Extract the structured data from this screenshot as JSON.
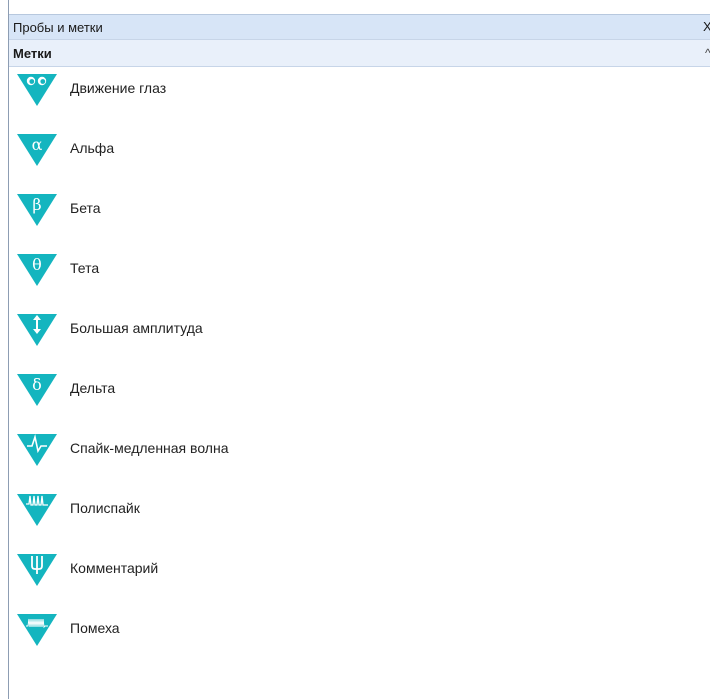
{
  "panel": {
    "title": "Пробы и метки",
    "close_symbol": "X",
    "section": "Метки",
    "collapse_symbol": "^"
  },
  "colors": {
    "marker_fill": "#14b5bf",
    "titlebar_bg": "#d7e5f7",
    "section_bg": "#e9f0fa"
  },
  "marks": [
    {
      "label": "Движение глаз",
      "icon": "eye-movement-icon",
      "glyph": ""
    },
    {
      "label": "Альфа",
      "icon": "alpha-icon",
      "glyph": "α"
    },
    {
      "label": "Бета",
      "icon": "beta-icon",
      "glyph": "β"
    },
    {
      "label": "Тета",
      "icon": "theta-icon",
      "glyph": "θ"
    },
    {
      "label": "Большая амплитуда",
      "icon": "high-amplitude-icon",
      "glyph": ""
    },
    {
      "label": "Дельта",
      "icon": "delta-icon",
      "glyph": "δ"
    },
    {
      "label": "Спайк-медленная волна",
      "icon": "spike-slow-wave-icon",
      "glyph": ""
    },
    {
      "label": "Полиспайк",
      "icon": "polyspike-icon",
      "glyph": ""
    },
    {
      "label": "Комментарий",
      "icon": "comment-icon",
      "glyph": ""
    },
    {
      "label": "Помеха",
      "icon": "noise-icon",
      "glyph": ""
    }
  ]
}
